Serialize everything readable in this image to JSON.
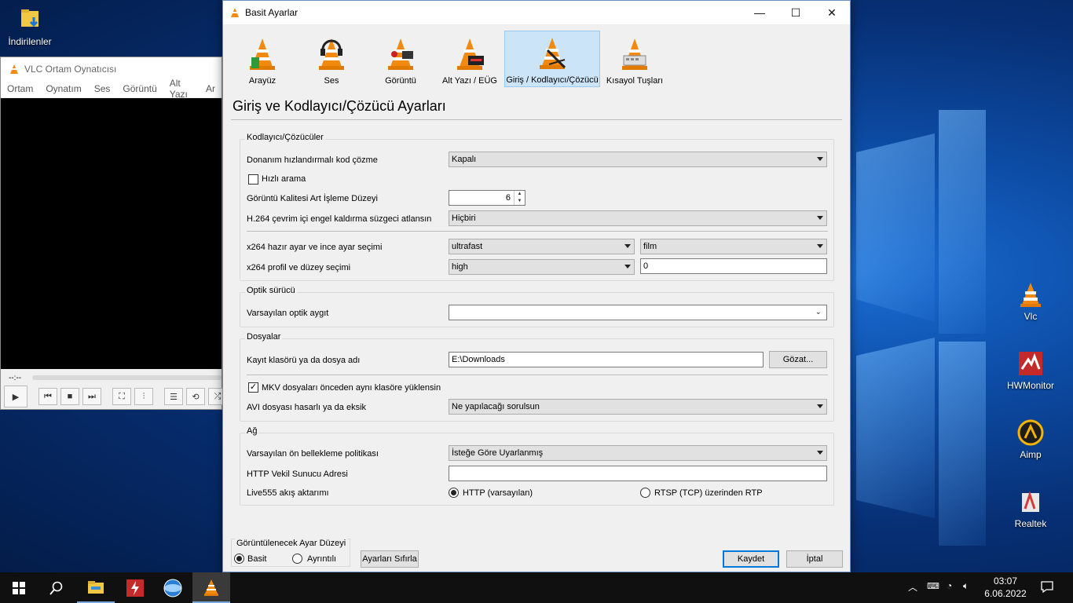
{
  "desktop": {
    "icons_left": [
      {
        "label": "İndirilenler"
      }
    ],
    "icons_right": [
      {
        "label": "Vlc"
      },
      {
        "label": "HWMonitor"
      },
      {
        "label": "Aimp"
      },
      {
        "label": "Realtek"
      }
    ]
  },
  "vlc_main": {
    "title": "VLC Ortam Oynatıcısı",
    "menu": [
      "Ortam",
      "Oynatım",
      "Ses",
      "Görüntü",
      "Alt Yazı",
      "Ar"
    ],
    "time": "--:--"
  },
  "dialog": {
    "title": "Basit Ayarlar",
    "categories": [
      {
        "label": "Arayüz"
      },
      {
        "label": "Ses"
      },
      {
        "label": "Görüntü"
      },
      {
        "label": "Alt Yazı / EÜG"
      },
      {
        "label": "Giriş / Kodlayıcı/Çözücü"
      },
      {
        "label": "Kısayol Tuşları"
      }
    ],
    "page_title": "Giriş ve Kodlayıcı/Çözücü Ayarları",
    "codecs": {
      "label": "Kodlayıcı/Çözücüler",
      "hw_label": "Donanım hızlandırmalı kod çözme",
      "hw_value": "Kapalı",
      "fast_seek_label": "Hızlı arama",
      "pp_label": "Görüntü Kalitesi Art İşleme Düzeyi",
      "pp_value": "6",
      "h264_label": "H.264 çevrim içi engel kaldırma süzgeci atlansın",
      "h264_value": "Hiçbiri",
      "x264_preset_label": "x264 hazır ayar ve ince ayar seçimi",
      "x264_preset": "ultrafast",
      "x264_tune": "film",
      "x264_profile_label": "x264 profil ve düzey seçimi",
      "x264_profile": "high",
      "x264_level": "0"
    },
    "optical": {
      "label": "Optik sürücü",
      "device_label": "Varsayılan optik aygıt",
      "device_value": ""
    },
    "files": {
      "label": "Dosyalar",
      "record_label": "Kayıt klasörü ya da dosya adı",
      "record_value": "E:\\Downloads",
      "browse": "Gözat...",
      "mkv_label": "MKV dosyaları önceden aynı klasöre yüklensin",
      "avi_label": "AVI dosyası hasarlı ya da eksik",
      "avi_value": "Ne yapılacağı sorulsun"
    },
    "network": {
      "label": "Ağ",
      "cache_label": "Varsayılan ön bellekleme politikası",
      "cache_value": "İsteğe Göre Uyarlanmış",
      "proxy_label": "HTTP Vekil Sunucu Adresi",
      "proxy_value": "",
      "live555_label": "Live555 akış aktarımı",
      "http_option": "HTTP (varsayılan)",
      "rtsp_option": "RTSP (TCP) üzerinden RTP"
    },
    "level": {
      "label": "Görüntülenecek Ayar Düzeyi",
      "simple": "Basit",
      "all": "Ayrıntılı"
    },
    "reset": "Ayarları Sıfırla",
    "save": "Kaydet",
    "cancel": "İptal"
  },
  "taskbar": {
    "time": "03:07",
    "date": "6.06.2022"
  }
}
